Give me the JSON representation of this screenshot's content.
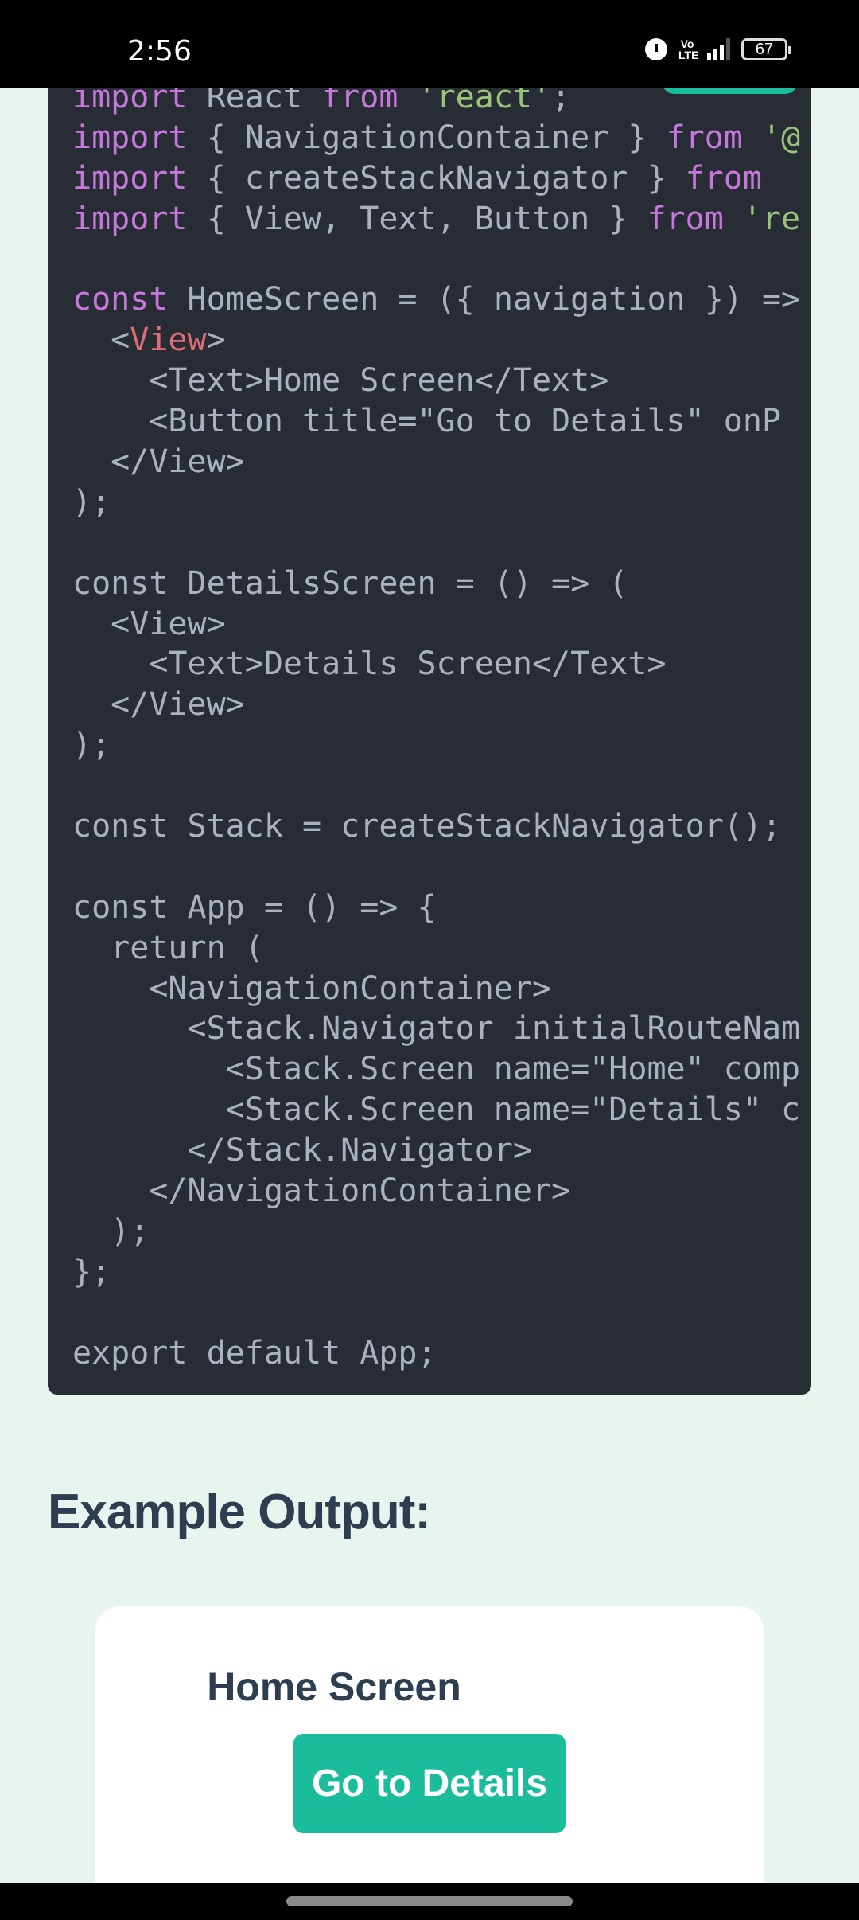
{
  "status_bar": {
    "time": "2:56",
    "network": "Vo LTE",
    "battery": "67",
    "icons": [
      "alarm-icon",
      "volte-icon",
      "signal-icon",
      "battery-icon"
    ]
  },
  "colors": {
    "accent": "#1abc9c",
    "code_bg": "#282c34",
    "page_bg": "#e8f5ee",
    "heading": "#2c3e50",
    "keyword": "#c678dd",
    "string": "#98c379",
    "tag": "#e06c75",
    "plain": "#abb2bf"
  },
  "code_lines": [
    [
      [
        "kw",
        "import"
      ],
      [
        "pl",
        " React "
      ],
      [
        "kw",
        "from"
      ],
      [
        "pl",
        " "
      ],
      [
        "str",
        "'react'"
      ],
      [
        "pl",
        ";"
      ]
    ],
    [
      [
        "kw",
        "import"
      ],
      [
        "pl",
        " { NavigationContainer } "
      ],
      [
        "kw",
        "from"
      ],
      [
        "pl",
        " "
      ],
      [
        "str",
        "'@"
      ]
    ],
    [
      [
        "kw",
        "import"
      ],
      [
        "pl",
        " { createStackNavigator } "
      ],
      [
        "kw",
        "from"
      ]
    ],
    [
      [
        "kw",
        "import"
      ],
      [
        "pl",
        " { View, Text, Button } "
      ],
      [
        "kw",
        "from"
      ],
      [
        "pl",
        " "
      ],
      [
        "str",
        "'re"
      ]
    ],
    [],
    [
      [
        "kw",
        "const"
      ],
      [
        "pl",
        " HomeScreen = ({ navigation }) =>"
      ]
    ],
    [
      [
        "pl",
        "  <"
      ],
      [
        "tag",
        "View"
      ],
      [
        "pl",
        ">"
      ]
    ],
    [
      [
        "pl",
        "    <Text>Home Screen</Text>"
      ]
    ],
    [
      [
        "pl",
        "    <Button title=\"Go to Details\" onP"
      ]
    ],
    [
      [
        "pl",
        "  </View>"
      ]
    ],
    [
      [
        "pl",
        ");"
      ]
    ],
    [],
    [
      [
        "pl",
        "const DetailsScreen = () => ("
      ]
    ],
    [
      [
        "pl",
        "  <View>"
      ]
    ],
    [
      [
        "pl",
        "    <Text>Details Screen</Text>"
      ]
    ],
    [
      [
        "pl",
        "  </View>"
      ]
    ],
    [
      [
        "pl",
        ");"
      ]
    ],
    [],
    [
      [
        "pl",
        "const Stack = createStackNavigator();"
      ]
    ],
    [],
    [
      [
        "pl",
        "const App = () => {"
      ]
    ],
    [
      [
        "pl",
        "  return ("
      ]
    ],
    [
      [
        "pl",
        "    <NavigationContainer>"
      ]
    ],
    [
      [
        "pl",
        "      <Stack.Navigator initialRouteNam"
      ]
    ],
    [
      [
        "pl",
        "        <Stack.Screen name=\"Home\" comp"
      ]
    ],
    [
      [
        "pl",
        "        <Stack.Screen name=\"Details\" c"
      ]
    ],
    [
      [
        "pl",
        "      </Stack.Navigator>"
      ]
    ],
    [
      [
        "pl",
        "    </NavigationContainer>"
      ]
    ],
    [
      [
        "pl",
        "  );"
      ]
    ],
    [
      [
        "pl",
        "};"
      ]
    ],
    [],
    [
      [
        "pl",
        "export default App;"
      ]
    ]
  ],
  "output_section": {
    "heading": "Example Output:",
    "screen_title": "Home Screen",
    "button_label": "Go to Details"
  }
}
